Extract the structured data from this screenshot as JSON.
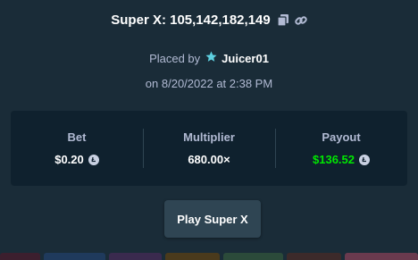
{
  "header": {
    "title": "Super X: 105,142,182,149",
    "copy_icon": "copy-icon",
    "link_icon": "link-icon"
  },
  "placed": {
    "prefix": "Placed by",
    "username": "Juicer01",
    "user_icon": "vip-star-icon"
  },
  "date": "on 8/20/2022 at 2:38 PM",
  "stats": {
    "bet_label": "Bet",
    "bet_value": "$0.20",
    "multiplier_label": "Multiplier",
    "multiplier_value": "680.00×",
    "payout_label": "Payout",
    "payout_value": "$136.52",
    "currency_icon": "litecoin-icon"
  },
  "play_button": "Play Super X",
  "colors": {
    "background": "#1a2c38",
    "panel": "#0f212e",
    "muted_text": "#b1bad3",
    "payout_green": "#00e701",
    "button": "#2f4553"
  }
}
